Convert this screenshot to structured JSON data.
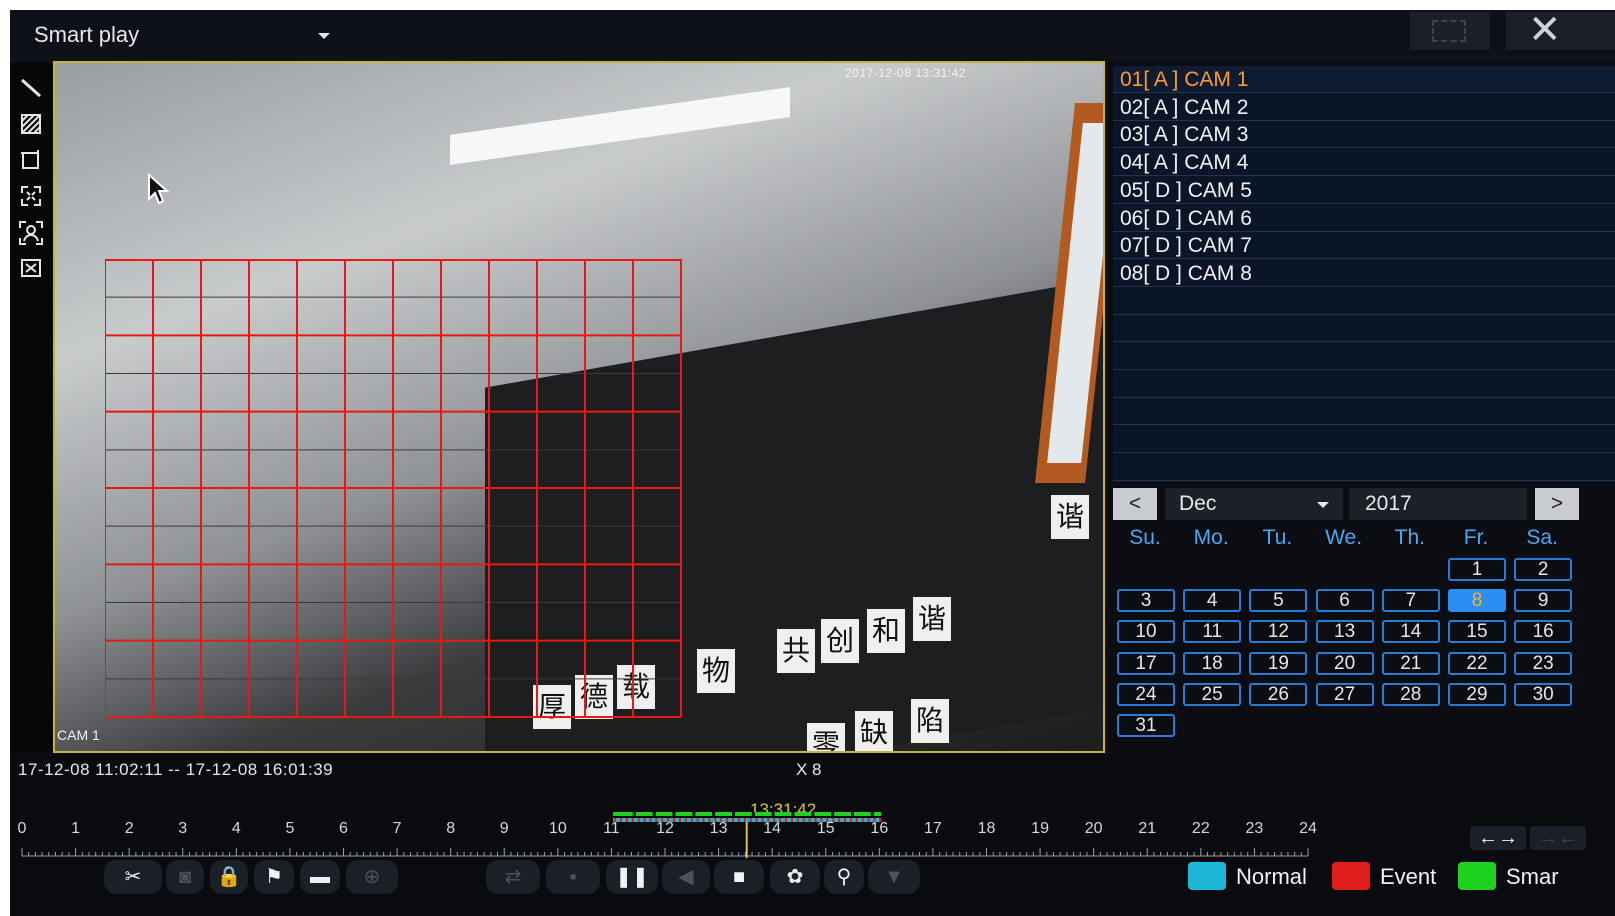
{
  "header": {
    "mode_select": "Smart play"
  },
  "video": {
    "timestamp": "2017-12-08 13:31:42",
    "cam_label": "CAM 1",
    "scene_text": [
      "厚",
      "德",
      "载",
      "物",
      "共",
      "创",
      "和",
      "谐",
      "零",
      "缺",
      "陷",
      "谐"
    ]
  },
  "cameras": [
    {
      "label": "01[ A ] CAM 1",
      "selected": true
    },
    {
      "label": "02[ A ] CAM 2",
      "selected": false
    },
    {
      "label": "03[ A ] CAM 3",
      "selected": false
    },
    {
      "label": "04[ A ] CAM 4",
      "selected": false
    },
    {
      "label": "05[ D ] CAM 5",
      "selected": false
    },
    {
      "label": "06[ D ] CAM 6",
      "selected": false
    },
    {
      "label": "07[ D ] CAM 7",
      "selected": false
    },
    {
      "label": "08[ D ] CAM 8",
      "selected": false
    }
  ],
  "calendar": {
    "prev": "<",
    "next": ">",
    "month": "Dec",
    "year": "2017",
    "weekdays": [
      "Su.",
      "Mo.",
      "Tu.",
      "We.",
      "Th.",
      "Fr.",
      "Sa."
    ],
    "first_weekday_index": 5,
    "days_in_month": 31,
    "selected_day": 8
  },
  "timeline": {
    "range": "17-12-08 11:02:11 -- 17-12-08 16:01:39",
    "speed": "X 8",
    "current_time": "13:31:42",
    "current_hour": 13.525,
    "hours": [
      "0",
      "1",
      "2",
      "3",
      "4",
      "5",
      "6",
      "7",
      "8",
      "9",
      "10",
      "11",
      "12",
      "13",
      "14",
      "15",
      "16",
      "17",
      "18",
      "19",
      "20",
      "21",
      "22",
      "23",
      "24"
    ]
  },
  "controls": {
    "cut": "✂",
    "lock": "🔒",
    "flag": "⚑",
    "folder": "▬",
    "pause": "❚❚",
    "stop": "■",
    "gear": "✿",
    "search": "⚲",
    "nav_arrows": "←→",
    "nav_arrows_disabled": "→←"
  },
  "legend": [
    {
      "label": "Normal",
      "color": "#1fb6d8"
    },
    {
      "label": "Event",
      "color": "#e11d1d"
    },
    {
      "label": "Smar",
      "color": "#1fd21f"
    }
  ],
  "colors": {
    "accent": "#2a8ef2",
    "selected_text": "#ff9a2c",
    "cal_border": "#2a7bd6",
    "grid": "#e61a12",
    "timeline_now": "#e0c33a"
  }
}
